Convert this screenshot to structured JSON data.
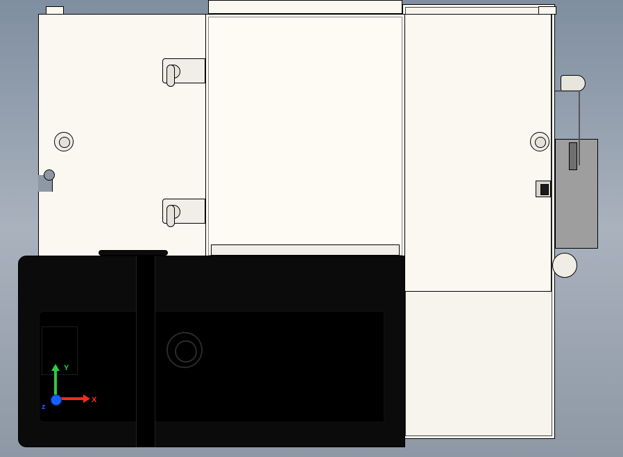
{
  "triad": {
    "x_label": "X",
    "y_label": "Y",
    "z_label": "z"
  }
}
